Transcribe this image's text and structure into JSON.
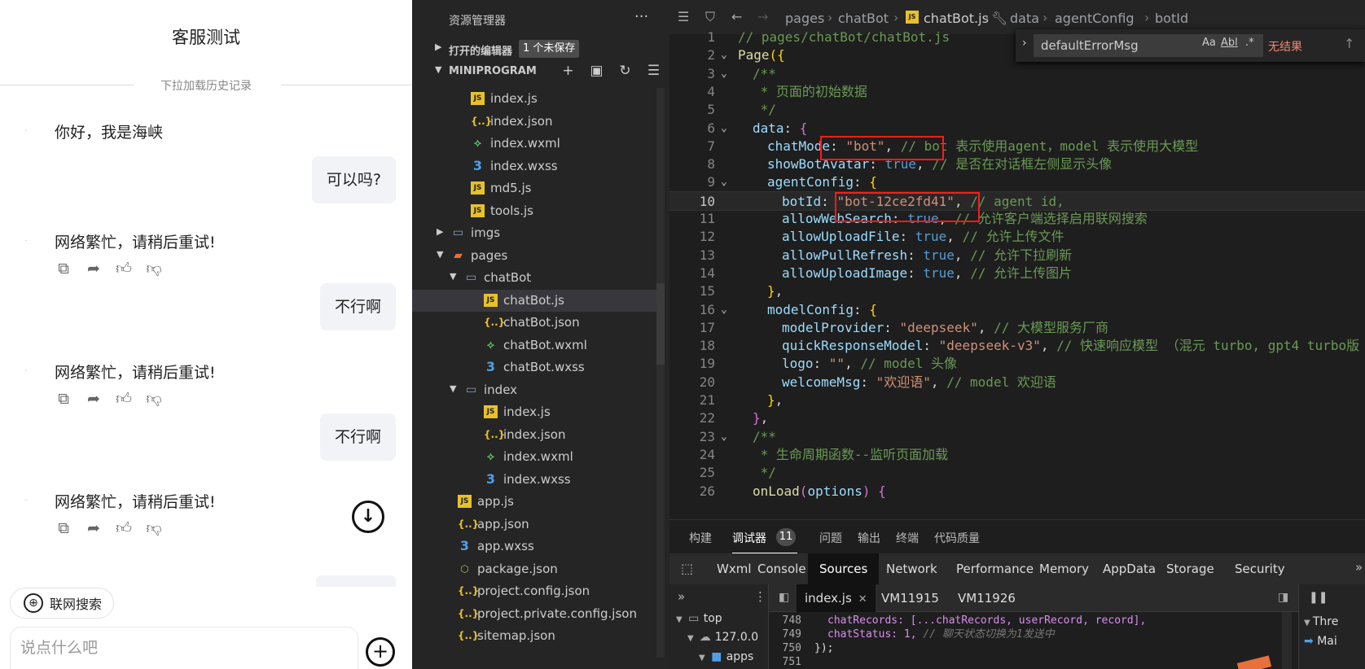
{
  "simulator": {
    "title": "客服测试",
    "history_hint": "下拉加载历史记录",
    "messages": [
      {
        "role": "bot",
        "text": "你好，我是海峡"
      },
      {
        "role": "user",
        "text": "可以吗?"
      },
      {
        "role": "bot",
        "text": "网络繁忙，请稍后重试!"
      },
      {
        "role": "user",
        "text": "不行啊"
      },
      {
        "role": "bot",
        "text": "网络繁忙，请稍后重试!"
      },
      {
        "role": "user",
        "text": "不行啊"
      },
      {
        "role": "bot",
        "text": "网络繁忙，请稍后重试!"
      }
    ],
    "web_search_label": "联网搜索",
    "input_placeholder": "说点什么吧",
    "icons": {
      "copy": "copy-icon",
      "share": "share-icon",
      "like": "thumbs-up-icon",
      "dislike": "thumbs-down-icon",
      "scroll": "arrow-down-circle-icon",
      "add": "plus-circle-icon",
      "globe": "globe-icon"
    }
  },
  "explorer": {
    "title": "资源管理器",
    "more": "···",
    "open_editors": "打开的编辑器",
    "unsaved_badge": "1 个未保存",
    "root": "MINIPROGRAM",
    "tree": [
      {
        "name": "index.js",
        "type": "js",
        "indent": 2
      },
      {
        "name": "index.json",
        "type": "json",
        "indent": 2
      },
      {
        "name": "index.wxml",
        "type": "wxml",
        "indent": 2
      },
      {
        "name": "index.wxss",
        "type": "wxss",
        "indent": 2
      },
      {
        "name": "md5.js",
        "type": "js",
        "indent": 2
      },
      {
        "name": "tools.js",
        "type": "js",
        "indent": 2
      },
      {
        "name": "imgs",
        "type": "folder",
        "indent": 1,
        "chevron": "▶"
      },
      {
        "name": "pages",
        "type": "pages",
        "indent": 1,
        "chevron": "▼"
      },
      {
        "name": "chatBot",
        "type": "folder",
        "indent": 2,
        "chevron": "▼",
        "selected": true
      },
      {
        "name": "chatBot.js",
        "type": "js",
        "indent": 3,
        "selected": true
      },
      {
        "name": "chatBot.json",
        "type": "json",
        "indent": 3
      },
      {
        "name": "chatBot.wxml",
        "type": "wxml",
        "indent": 3
      },
      {
        "name": "chatBot.wxss",
        "type": "wxss",
        "indent": 3
      },
      {
        "name": "index",
        "type": "folder",
        "indent": 2,
        "chevron": "▼"
      },
      {
        "name": "index.js",
        "type": "js",
        "indent": 3
      },
      {
        "name": "index.json",
        "type": "json",
        "indent": 3
      },
      {
        "name": "index.wxml",
        "type": "wxml",
        "indent": 3
      },
      {
        "name": "index.wxss",
        "type": "wxss",
        "indent": 3
      },
      {
        "name": "app.js",
        "type": "js",
        "indent": 1
      },
      {
        "name": "app.json",
        "type": "json",
        "indent": 1
      },
      {
        "name": "app.wxss",
        "type": "wxss",
        "indent": 1
      },
      {
        "name": "package.json",
        "type": "pkg",
        "indent": 1
      },
      {
        "name": "project.config.json",
        "type": "json",
        "indent": 1
      },
      {
        "name": "project.private.config.json",
        "type": "json",
        "indent": 1
      },
      {
        "name": "sitemap.json",
        "type": "json",
        "indent": 1
      }
    ]
  },
  "breadcrumb": [
    "pages",
    "chatBot",
    "chatBot.js",
    "data",
    "agentConfig",
    "botId"
  ],
  "find": {
    "value": "defaultErrorMsg",
    "opt_case": "Aa",
    "opt_word": "Abl",
    "opt_regex": ".*",
    "result": "无结果"
  },
  "code_lines": [
    {
      "n": "1",
      "fold": "",
      "indent": 0,
      "tokens": [
        [
          "com",
          "// pages/chatBot/chatBot.js"
        ]
      ]
    },
    {
      "n": "2",
      "fold": "v",
      "indent": 0,
      "tokens": [
        [
          "fn",
          "Page"
        ],
        [
          "yel",
          "({"
        ]
      ]
    },
    {
      "n": "3",
      "fold": "v",
      "indent": 1,
      "tokens": [
        [
          "com",
          "/**"
        ]
      ]
    },
    {
      "n": "4",
      "fold": "",
      "indent": 1,
      "tokens": [
        [
          "com",
          " * 页面的初始数据"
        ]
      ]
    },
    {
      "n": "5",
      "fold": "",
      "indent": 1,
      "tokens": [
        [
          "com",
          " */"
        ]
      ]
    },
    {
      "n": "6",
      "fold": "v",
      "indent": 1,
      "tokens": [
        [
          "prop",
          "data"
        ],
        [
          "txt",
          ": "
        ],
        [
          "pur",
          "{"
        ]
      ]
    },
    {
      "n": "7",
      "fold": "",
      "indent": 2,
      "tokens": [
        [
          "prop",
          "chatMode"
        ],
        [
          "txt",
          ": "
        ],
        [
          "str",
          "\"bot\""
        ],
        [
          "txt",
          ", "
        ],
        [
          "com",
          "// bot 表示使用agent，model 表示使用大模型"
        ]
      ]
    },
    {
      "n": "8",
      "fold": "",
      "indent": 2,
      "tokens": [
        [
          "prop",
          "showBotAvatar"
        ],
        [
          "txt",
          ": "
        ],
        [
          "kw",
          "true"
        ],
        [
          "txt",
          ", "
        ],
        [
          "com",
          "// 是否在对话框左侧显示头像"
        ]
      ]
    },
    {
      "n": "9",
      "fold": "v",
      "indent": 2,
      "tokens": [
        [
          "prop",
          "agentConfig"
        ],
        [
          "txt",
          ": "
        ],
        [
          "yel",
          "{"
        ]
      ]
    },
    {
      "n": "10",
      "fold": "",
      "indent": 3,
      "active": true,
      "tokens": [
        [
          "prop",
          "botId"
        ],
        [
          "txt",
          ": "
        ],
        [
          "str",
          "\"bot-12ce2fd41\""
        ],
        [
          "txt",
          ", "
        ],
        [
          "com",
          "// agent id,"
        ]
      ]
    },
    {
      "n": "11",
      "fold": "",
      "indent": 3,
      "tokens": [
        [
          "prop",
          "allowWebSearch"
        ],
        [
          "txt",
          ": "
        ],
        [
          "kw",
          "true"
        ],
        [
          "txt",
          ", "
        ],
        [
          "com",
          "// 允许客户端选择启用联网搜索"
        ]
      ]
    },
    {
      "n": "12",
      "fold": "",
      "indent": 3,
      "tokens": [
        [
          "prop",
          "allowUploadFile"
        ],
        [
          "txt",
          ": "
        ],
        [
          "kw",
          "true"
        ],
        [
          "txt",
          ", "
        ],
        [
          "com",
          "// 允许上传文件"
        ]
      ]
    },
    {
      "n": "13",
      "fold": "",
      "indent": 3,
      "tokens": [
        [
          "prop",
          "allowPullRefresh"
        ],
        [
          "txt",
          ": "
        ],
        [
          "kw",
          "true"
        ],
        [
          "txt",
          ", "
        ],
        [
          "com",
          "// 允许下拉刷新"
        ]
      ]
    },
    {
      "n": "14",
      "fold": "",
      "indent": 3,
      "tokens": [
        [
          "prop",
          "allowUploadImage"
        ],
        [
          "txt",
          ": "
        ],
        [
          "kw",
          "true"
        ],
        [
          "txt",
          ", "
        ],
        [
          "com",
          "// 允许上传图片"
        ]
      ]
    },
    {
      "n": "15",
      "fold": "",
      "indent": 2,
      "tokens": [
        [
          "yel",
          "}"
        ],
        [
          "txt",
          ","
        ]
      ]
    },
    {
      "n": "16",
      "fold": "v",
      "indent": 2,
      "tokens": [
        [
          "prop",
          "modelConfig"
        ],
        [
          "txt",
          ": "
        ],
        [
          "yel",
          "{"
        ]
      ]
    },
    {
      "n": "17",
      "fold": "",
      "indent": 3,
      "tokens": [
        [
          "prop",
          "modelProvider"
        ],
        [
          "txt",
          ": "
        ],
        [
          "str",
          "\"deepseek\""
        ],
        [
          "txt",
          ", "
        ],
        [
          "com",
          "// 大模型服务厂商"
        ]
      ]
    },
    {
      "n": "18",
      "fold": "",
      "indent": 3,
      "tokens": [
        [
          "prop",
          "quickResponseModel"
        ],
        [
          "txt",
          ": "
        ],
        [
          "str",
          "\"deepseek-v3\""
        ],
        [
          "txt",
          ", "
        ],
        [
          "com",
          "// 快速响应模型 （混元 turbo, gpt4 turbo版"
        ]
      ]
    },
    {
      "n": "19",
      "fold": "",
      "indent": 3,
      "tokens": [
        [
          "prop",
          "logo"
        ],
        [
          "txt",
          ": "
        ],
        [
          "str",
          "\"\""
        ],
        [
          "txt",
          ", "
        ],
        [
          "com",
          "// model 头像"
        ]
      ]
    },
    {
      "n": "20",
      "fold": "",
      "indent": 3,
      "tokens": [
        [
          "prop",
          "welcomeMsg"
        ],
        [
          "txt",
          ": "
        ],
        [
          "str",
          "\"欢迎语\""
        ],
        [
          "txt",
          ", "
        ],
        [
          "com",
          "// model 欢迎语"
        ]
      ]
    },
    {
      "n": "21",
      "fold": "",
      "indent": 2,
      "tokens": [
        [
          "yel",
          "}"
        ],
        [
          "txt",
          ","
        ]
      ]
    },
    {
      "n": "22",
      "fold": "",
      "indent": 1,
      "tokens": [
        [
          "pur",
          "}"
        ],
        [
          "txt",
          ","
        ]
      ]
    },
    {
      "n": "23",
      "fold": "v",
      "indent": 1,
      "tokens": [
        [
          "com",
          "/**"
        ]
      ]
    },
    {
      "n": "24",
      "fold": "",
      "indent": 1,
      "tokens": [
        [
          "com",
          " * 生命周期函数--监听页面加载"
        ]
      ]
    },
    {
      "n": "25",
      "fold": "",
      "indent": 1,
      "tokens": [
        [
          "com",
          " */"
        ]
      ]
    },
    {
      "n": "26",
      "fold": "",
      "indent": 1,
      "tokens": [
        [
          "fn",
          "onLoad"
        ],
        [
          "pur",
          "("
        ],
        [
          "prop",
          "options"
        ],
        [
          "pur",
          ")"
        ],
        [
          "txt",
          " "
        ],
        [
          "pur",
          "{"
        ]
      ]
    }
  ],
  "panel": {
    "tabs": [
      "构建",
      "调试器",
      "问题",
      "输出",
      "终端",
      "代码质量"
    ],
    "active_tab": "调试器",
    "badge": "11",
    "devtools_tabs": [
      "Wxml",
      "Console",
      "Sources",
      "Network",
      "Performance",
      "Memory",
      "AppData",
      "Storage",
      "Security"
    ],
    "active_devtool": "Sources",
    "sources_tree": [
      "top",
      "127.0.0",
      "apps"
    ],
    "source_tabs": [
      "index.js",
      "VM11915",
      "VM11926"
    ],
    "source_lines": [
      {
        "n": "748",
        "code": "chatRecords: [...chatRecords, userRecord, record],",
        "comment": ""
      },
      {
        "n": "749",
        "code": "chatStatus: 1, ",
        "comment": "// 聊天状态切换为1发送中"
      },
      {
        "n": "750",
        "code": "});",
        "comment": ""
      },
      {
        "n": "751",
        "code": "",
        "comment": ""
      }
    ],
    "right_rows": [
      "Thre",
      "Mai"
    ]
  }
}
